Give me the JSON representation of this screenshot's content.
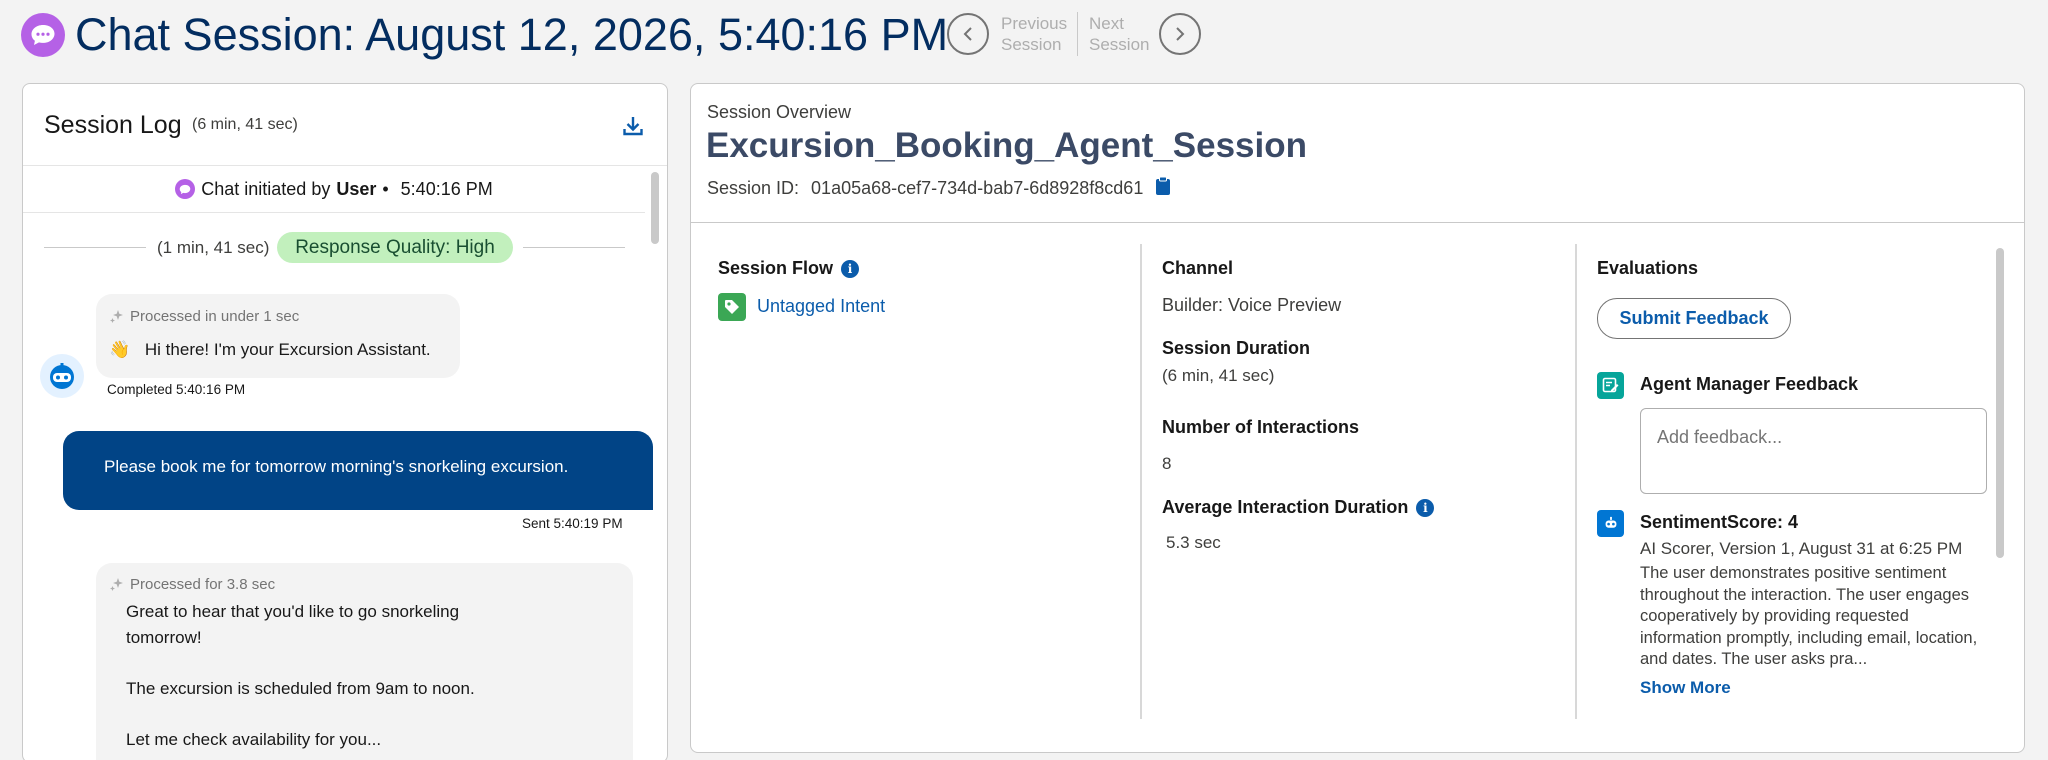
{
  "header": {
    "title": "Chat Session: August 12, 2026, 5:40:16 PM",
    "prev_label_1": "Previous",
    "prev_label_2": "Session",
    "next_label_1": "Next",
    "next_label_2": "Session"
  },
  "session_log": {
    "title": "Session Log",
    "duration": "(6 min, 41 sec)",
    "initiated_prefix": "Chat initiated by",
    "initiated_by": "User",
    "initiated_sep": "•",
    "initiated_time": "5:40:16 PM",
    "quality_duration": "(1 min, 41 sec)",
    "quality_label": "Response Quality: High",
    "messages": [
      {
        "processed": "Processed in under 1 sec",
        "emoji": "👋",
        "text": "Hi there! I'm your Excursion Assistant.",
        "status": "Completed 5:40:16 PM"
      },
      {
        "text": "Please book me for tomorrow morning's snorkeling excursion.",
        "status": "Sent 5:40:19 PM"
      },
      {
        "processed": "Processed for 3.8 sec",
        "line1": "Great to hear that you'd like to go snorkeling",
        "line2": "tomorrow!",
        "line3": "The excursion is scheduled from 9am to noon.",
        "line4": "Let me check availability for you..."
      }
    ]
  },
  "overview": {
    "label": "Session Overview",
    "title": "Excursion_Booking_Agent_Session",
    "session_id_label": "Session ID:",
    "session_id": "01a05a68-cef7-734d-bab7-6d8928f8cd61",
    "session_flow": {
      "heading": "Session Flow",
      "intent": "Untagged Intent"
    },
    "channel": {
      "heading": "Channel",
      "value": "Builder: Voice Preview"
    },
    "duration": {
      "heading": "Session Duration",
      "value": "(6 min, 41 sec)"
    },
    "interactions": {
      "heading": "Number of Interactions",
      "value": "8"
    },
    "avg_duration": {
      "heading": "Average Interaction Duration",
      "value": "5.3 sec"
    },
    "evaluations": {
      "heading": "Evaluations",
      "submit": "Submit Feedback",
      "manager_heading": "Agent Manager Feedback",
      "placeholder": "Add feedback...",
      "score_heading": "SentimentScore: 4",
      "scorer": "AI Scorer, Version 1, August 31 at 6:25 PM",
      "description": "The user demonstrates positive sentiment throughout the interaction. The user engages cooperatively by providing requested information promptly, including email, location, and dates. The user asks pra...",
      "show_more": "Show More"
    }
  },
  "colors": {
    "brand_purple": "#b561e6",
    "title_navy": "#032d60",
    "link_blue": "#0b5cab",
    "user_bubble": "#014486",
    "quality_green": "#c2f0bd"
  }
}
